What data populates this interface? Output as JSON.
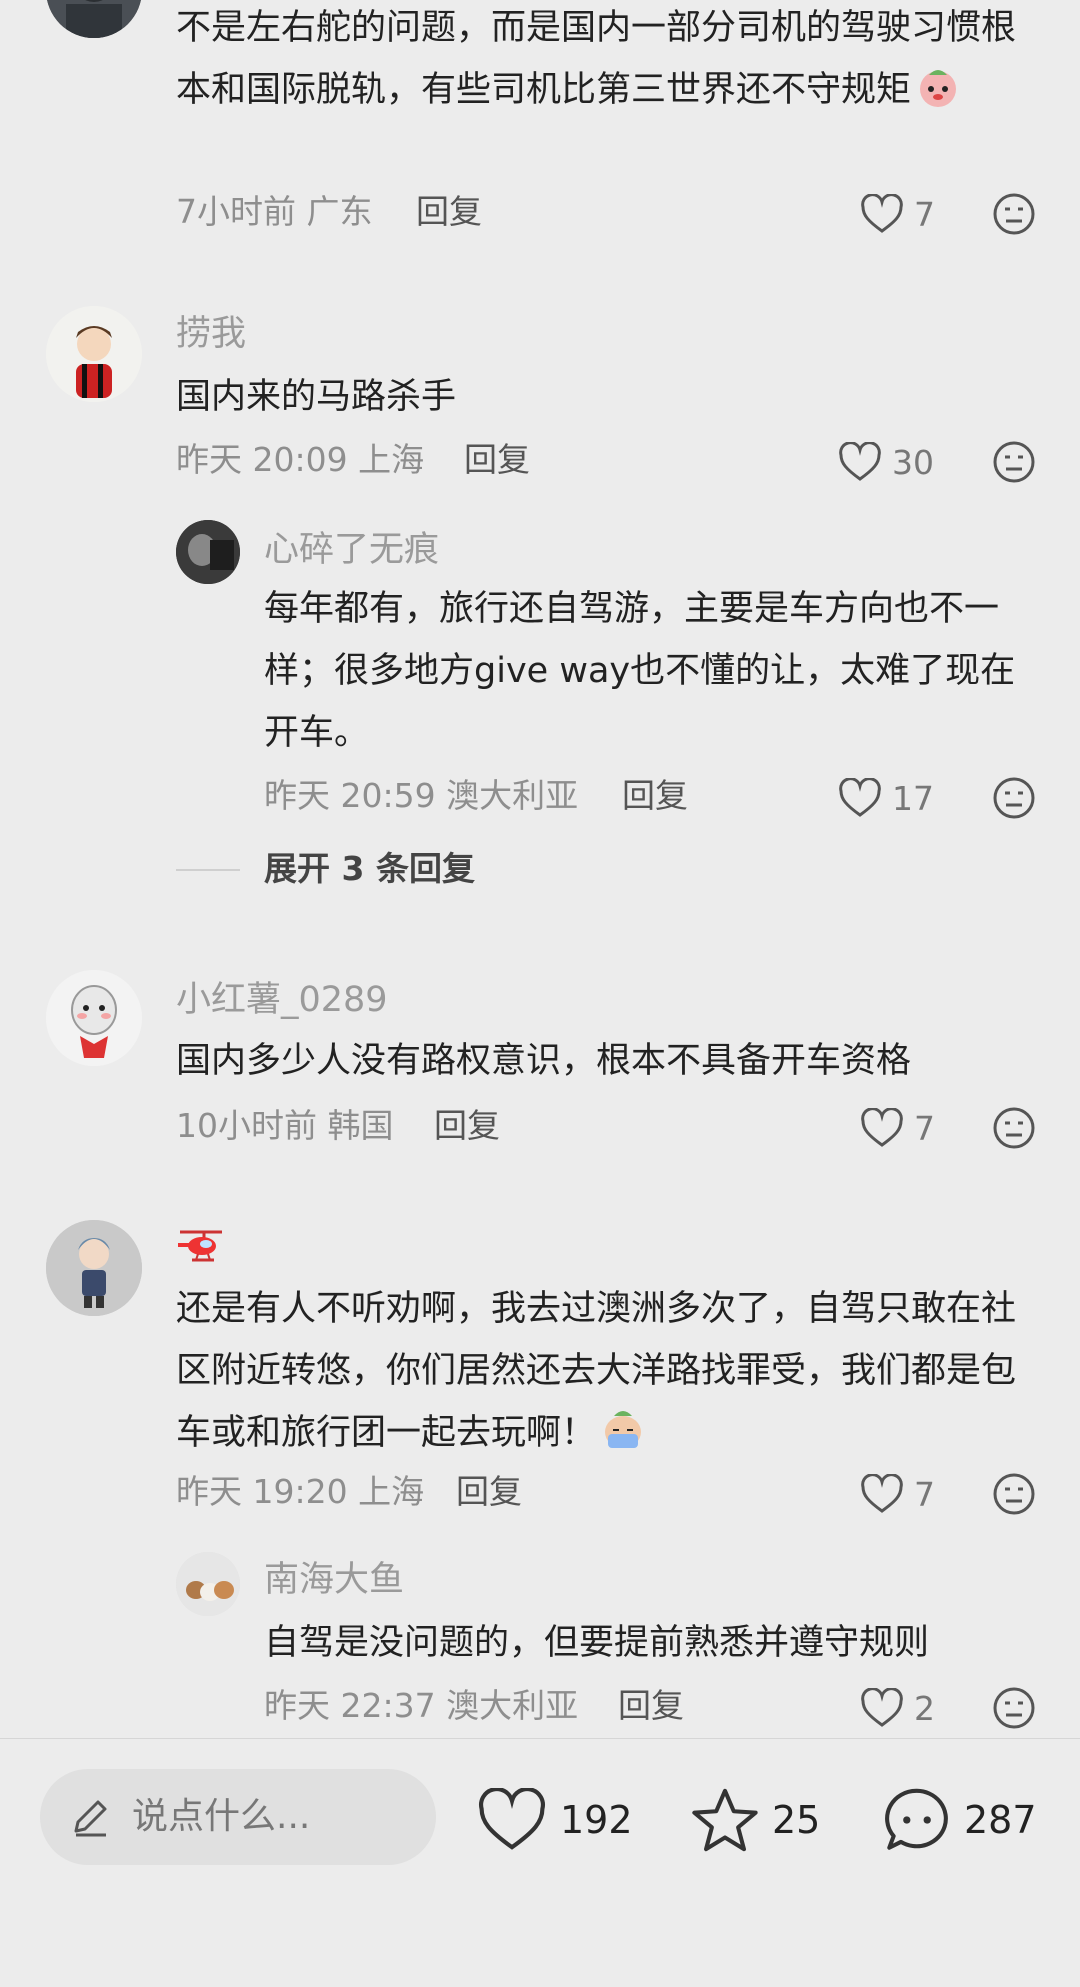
{
  "comments": [
    {
      "text": "不是左右舵的问题，而是国内一部分司机的驾驶习惯根本和国际脱轨，有些司机比第三世界还不守规矩",
      "time": "7小时前 广东",
      "reply": "回复",
      "likes": "7"
    },
    {
      "username": "捞我",
      "text": "国内来的马路杀手",
      "time": "昨天 20:09 上海",
      "reply": "回复",
      "likes": "30"
    },
    {
      "username": "心碎了无痕",
      "text": "每年都有，旅行还自驾游，主要是车方向也不一样；很多地方give way也不懂的让，太难了现在开车。",
      "time": "昨天 20:59 澳大利亚",
      "reply": "回复",
      "likes": "17"
    },
    {
      "username": "小红薯_0289",
      "text": "国内多少人没有路权意识，根本不具备开车资格",
      "time": "10小时前 韩国",
      "reply": "回复",
      "likes": "7"
    },
    {
      "username_icon": "helicopter-emoji",
      "text": "还是有人不听劝啊，我去过澳洲多次了，自驾只敢在社区附近转悠，你们居然还去大洋路找罪受，我们都是包车或和旅行团一起去玩啊！",
      "time": "昨天 19:20 上海",
      "reply": "回复",
      "likes": "7"
    },
    {
      "username": "南海大鱼",
      "text": "自驾是没问题的，但要提前熟悉并遵守规则",
      "time": "昨天 22:37 澳大利亚",
      "reply": "回复",
      "likes": "2"
    }
  ],
  "expand_replies": "展开 3 条回复",
  "bottom_bar": {
    "input_placeholder": "说点什么...",
    "likes": "192",
    "stars": "25",
    "comments": "287"
  },
  "colors": {
    "background": "#ececec",
    "username": "#9a9a9a",
    "meta": "#8e8e8e"
  }
}
